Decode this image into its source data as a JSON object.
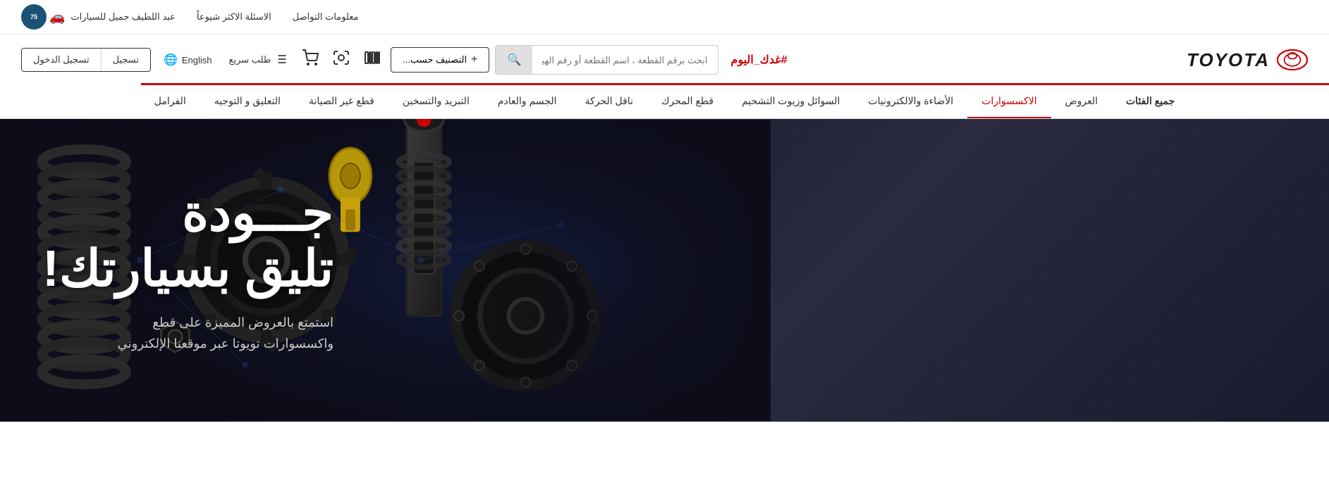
{
  "topbar": {
    "company_name": "عبد اللطيف جميل للسيارات",
    "company_logo_text": "75",
    "faq_label": "الاسئلة الاكثر شيوعاً",
    "contact_label": "معلومات التواصل"
  },
  "header": {
    "today_tag": "#غدك_اليوم",
    "logo_text": "TOYOTA",
    "search_placeholder": "ابحث برقم القطعة ، اسم القطعة أو رقم الهيكل",
    "filter_label": "التصنيف حسب...",
    "filter_plus": "+",
    "lang_label": "English",
    "cart_icon": "🛒",
    "quick_order_label": "طلب سريع",
    "scan_icon": "🔍",
    "barcode_icon": "📷",
    "search_icon": "🔍",
    "login_label": "تسجيل",
    "register_label": "تسجيل الدخول"
  },
  "nav": {
    "items": [
      {
        "label": "جميع الفئات",
        "active": false
      },
      {
        "label": "العروض",
        "active": false
      },
      {
        "label": "الاكسسوارات",
        "active": true
      },
      {
        "label": "الأضاءة والالكترونيات",
        "active": false
      },
      {
        "label": "السوائل وزيوت التشحيم",
        "active": false
      },
      {
        "label": "قطع المحرك",
        "active": false
      },
      {
        "label": "ناقل الحركة",
        "active": false
      },
      {
        "label": "الجسم والعادم",
        "active": false
      },
      {
        "label": "التبريد والتسخين",
        "active": false
      },
      {
        "label": "قطع غير الصيانة",
        "active": false
      },
      {
        "label": "التعليق و التوجيه",
        "active": false
      },
      {
        "label": "الفرامل",
        "active": false
      }
    ]
  },
  "hero": {
    "headline_line1": "جـــودة",
    "headline_line2": "تليق بسيارتك!",
    "subtext_line1": "استمتع بالعروض المميزة على قطع",
    "subtext_line2": "واكسسوارات تويوتا عبر موقعنا الإلكتروني"
  }
}
